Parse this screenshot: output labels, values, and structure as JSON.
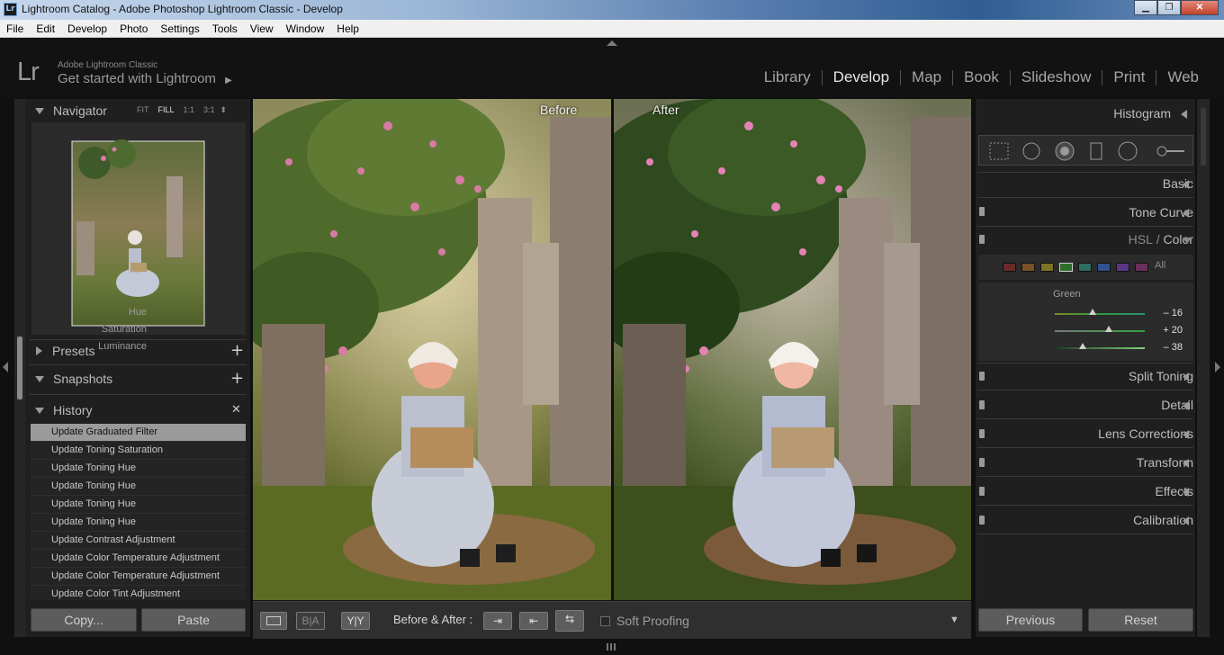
{
  "window": {
    "title": "Lightroom Catalog - Adobe Photoshop Lightroom Classic - Develop",
    "app_icon": "Lr",
    "minimize": "▁",
    "maximize": "❐",
    "close": "✕"
  },
  "menu": [
    "File",
    "Edit",
    "Develop",
    "Photo",
    "Settings",
    "Tools",
    "View",
    "Window",
    "Help"
  ],
  "identity": {
    "logo": "Lr",
    "line1": "Adobe Lightroom Classic",
    "line2": "Get started with Lightroom",
    "line2_arrow": "▶"
  },
  "modules": [
    {
      "label": "Library",
      "active": false
    },
    {
      "label": "Develop",
      "active": true
    },
    {
      "label": "Map",
      "active": false
    },
    {
      "label": "Book",
      "active": false
    },
    {
      "label": "Slideshow",
      "active": false
    },
    {
      "label": "Print",
      "active": false
    },
    {
      "label": "Web",
      "active": false
    }
  ],
  "left": {
    "navigator": {
      "title": "Navigator",
      "zoom": [
        "FIT",
        "FILL",
        "1:1",
        "3:1"
      ],
      "zoom_active": "FILL",
      "zoom_arrow": "⬍"
    },
    "presets": {
      "title": "Presets",
      "add": "+"
    },
    "snapshots": {
      "title": "Snapshots",
      "add": "+"
    },
    "history": {
      "title": "History",
      "clear": "✕",
      "items": [
        "Update Graduated Filter",
        "Update Toning Saturation",
        "Update Toning Hue",
        "Update Toning Hue",
        "Update Toning Hue",
        "Update Toning Hue",
        "Update Contrast Adjustment",
        "Update Color Temperature Adjustment",
        "Update Color Temperature Adjustment",
        "Update Color Tint Adjustment"
      ],
      "selected_index": 0
    },
    "copy_label": "Copy...",
    "paste_label": "Paste"
  },
  "view": {
    "before_label": "Before",
    "after_label": "After"
  },
  "toolbar": {
    "ba_label": "Before & After :",
    "ba_short": "B|A",
    "yy_label": "Y|Y",
    "swap_icon": "⇆",
    "copy_left_icon": "⇤",
    "copy_right_icon": "⇥",
    "soft_proofing": "Soft Proofing",
    "dropdown": "▼"
  },
  "right": {
    "histogram": "Histogram",
    "sections": [
      "Basic",
      "Tone Curve"
    ],
    "hsl_label": "HSL",
    "hsl_sep": " / ",
    "color_label": "Color",
    "swatch_colors": [
      "#6b2a2a",
      "#7a5226",
      "#7d7426",
      "#2f6e2a",
      "#2e6d64",
      "#33508f",
      "#5c3685",
      "#6c2f5c"
    ],
    "swatch_all": "All",
    "group": "Green",
    "sliders": [
      {
        "label": "Hue",
        "value": "– 16",
        "pos": 0.42
      },
      {
        "label": "Saturation",
        "value": "+ 20",
        "pos": 0.6
      },
      {
        "label": "Luminance",
        "value": "– 38",
        "pos": 0.31
      }
    ],
    "more_sections": [
      "Split Toning",
      "Detail",
      "Lens Corrections",
      "Transform",
      "Effects",
      "Calibration"
    ],
    "previous": "Previous",
    "reset": "Reset"
  }
}
